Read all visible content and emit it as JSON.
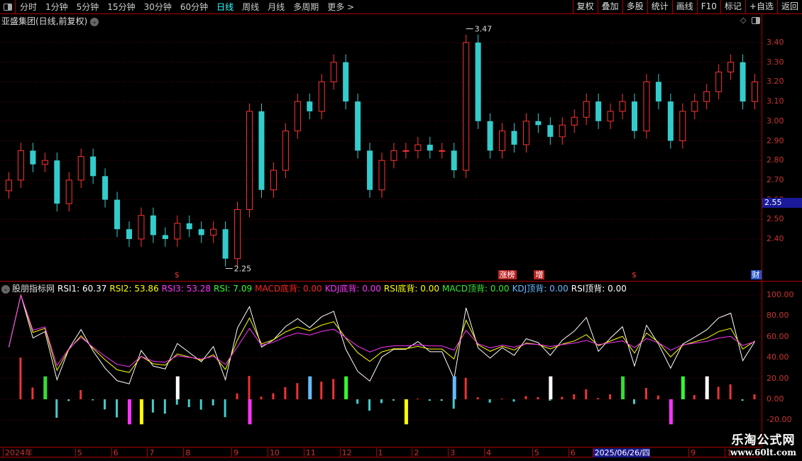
{
  "toolbar": {
    "periods": [
      "分时",
      "1分钟",
      "5分钟",
      "15分钟",
      "30分钟",
      "60分钟",
      "日线",
      "周线",
      "月线",
      "多周期",
      "更多 >"
    ],
    "active": "日线",
    "right": [
      "复权",
      "叠加",
      "多股",
      "统计",
      "画线",
      "F10",
      "标记",
      "+自选",
      "返回"
    ]
  },
  "title": "亚盛集团(日线,前复权)",
  "price_axis": {
    "labels": [
      "3.40",
      "3.30",
      "3.20",
      "3.10",
      "3.00",
      "2.90",
      "2.80",
      "2.70",
      "2.60",
      "2.50",
      "2.40"
    ],
    "current": "2.55"
  },
  "annotations": {
    "high": "3.47",
    "low": "2.25"
  },
  "events": [
    {
      "idx": 14,
      "text": "$",
      "color": "#e33",
      "bg": ""
    },
    {
      "idx": 41,
      "text": "涨榜",
      "color": "#fff",
      "bg": "#b22"
    },
    {
      "idx": 44,
      "text": "增",
      "color": "#fff",
      "bg": "#b22"
    },
    {
      "idx": 52,
      "text": "$",
      "color": "#e33",
      "bg": ""
    },
    {
      "idx": 62,
      "text": "财",
      "color": "#fff",
      "bg": "#2255cc"
    }
  ],
  "indicator": {
    "name": "股朋指标网",
    "items": [
      {
        "label": "RSI1: 60.37",
        "color": "#ffffff"
      },
      {
        "label": "RSI2: 53.86",
        "color": "#ffff00"
      },
      {
        "label": "RSI3: 53.28",
        "color": "#ff33ff"
      },
      {
        "label": "RSI: 7.09",
        "color": "#33ff33"
      },
      {
        "label": "MACD底背: 0.00",
        "color": "#ff2222"
      },
      {
        "label": "KDJ底背: 0.00",
        "color": "#ff33ff"
      },
      {
        "label": "RSI底背: 0.00",
        "color": "#ffff00"
      },
      {
        "label": "MACD顶背: 0.00",
        "color": "#33ee33"
      },
      {
        "label": "KDJ顶背: 0.00",
        "color": "#66bbff"
      },
      {
        "label": "RSI顶背: 0.00",
        "color": "#ffffff"
      }
    ],
    "axis": [
      "100.00",
      "80.00",
      "60.00",
      "40.00",
      "20.00",
      "0.00",
      "-20.00"
    ],
    "signals": [
      {
        "idx": 3,
        "color": "#33dd33",
        "dir": "up"
      },
      {
        "idx": 10,
        "color": "#ff33ff",
        "dir": "down"
      },
      {
        "idx": 11,
        "color": "#ffff00",
        "dir": "down"
      },
      {
        "idx": 14,
        "color": "#ffffff",
        "dir": "up"
      },
      {
        "idx": 20,
        "color": "#ff33ff",
        "dir": "down"
      },
      {
        "idx": 25,
        "color": "#66bbff",
        "dir": "up"
      },
      {
        "idx": 28,
        "color": "#33ff33",
        "dir": "up"
      },
      {
        "idx": 33,
        "color": "#ffff00",
        "dir": "down"
      },
      {
        "idx": 37,
        "color": "#66bbff",
        "dir": "up"
      },
      {
        "idx": 45,
        "color": "#ffffff",
        "dir": "up"
      },
      {
        "idx": 51,
        "color": "#33dd33",
        "dir": "up"
      },
      {
        "idx": 55,
        "color": "#ff33ff",
        "dir": "down"
      },
      {
        "idx": 56,
        "color": "#33ff33",
        "dir": "up"
      },
      {
        "idx": 58,
        "color": "#ffffff",
        "dir": "up"
      }
    ]
  },
  "colors": {
    "up": "#ff3333",
    "down": "#33cccc",
    "grid": "#5a0000"
  },
  "dates": [
    {
      "idx": 0,
      "label": "2024年"
    },
    {
      "idx": 6,
      "label": "5"
    },
    {
      "idx": 9,
      "label": "6"
    },
    {
      "idx": 12,
      "label": "7"
    },
    {
      "idx": 15,
      "label": "8"
    },
    {
      "idx": 19,
      "label": "9"
    },
    {
      "idx": 22,
      "label": "10"
    },
    {
      "idx": 25,
      "label": "11"
    },
    {
      "idx": 28,
      "label": "12"
    },
    {
      "idx": 31,
      "label": "1"
    },
    {
      "idx": 34,
      "label": "2"
    },
    {
      "idx": 37,
      "label": "3"
    },
    {
      "idx": 40,
      "label": "4"
    },
    {
      "idx": 44,
      "label": "5"
    },
    {
      "idx": 47,
      "label": "6"
    },
    {
      "idx": 49,
      "label": "2025/06/26/四",
      "highlight": true
    },
    {
      "idx": 57,
      "label": "9"
    },
    {
      "idx": 60,
      "label": "1"
    }
  ],
  "closes": [
    2.7,
    2.85,
    2.78,
    2.8,
    2.58,
    2.7,
    2.82,
    2.72,
    2.6,
    2.45,
    2.4,
    2.52,
    2.42,
    2.4,
    2.48,
    2.45,
    2.42,
    2.45,
    2.3,
    2.55,
    3.05,
    2.65,
    2.75,
    2.95,
    3.1,
    3.05,
    3.2,
    3.3,
    3.1,
    2.85,
    2.65,
    2.8,
    2.85,
    2.85,
    2.88,
    2.85,
    2.85,
    2.75,
    3.4,
    3.0,
    2.85,
    2.95,
    2.88,
    3.0,
    2.98,
    2.92,
    2.98,
    3.02,
    3.1,
    3.0,
    3.05,
    3.1,
    2.95,
    3.2,
    3.1,
    2.9,
    3.05,
    3.1,
    3.15,
    3.25,
    3.3,
    3.1,
    3.2
  ],
  "watermark": {
    "line1": "乐淘公式网",
    "line2": "www.60lt.com"
  }
}
